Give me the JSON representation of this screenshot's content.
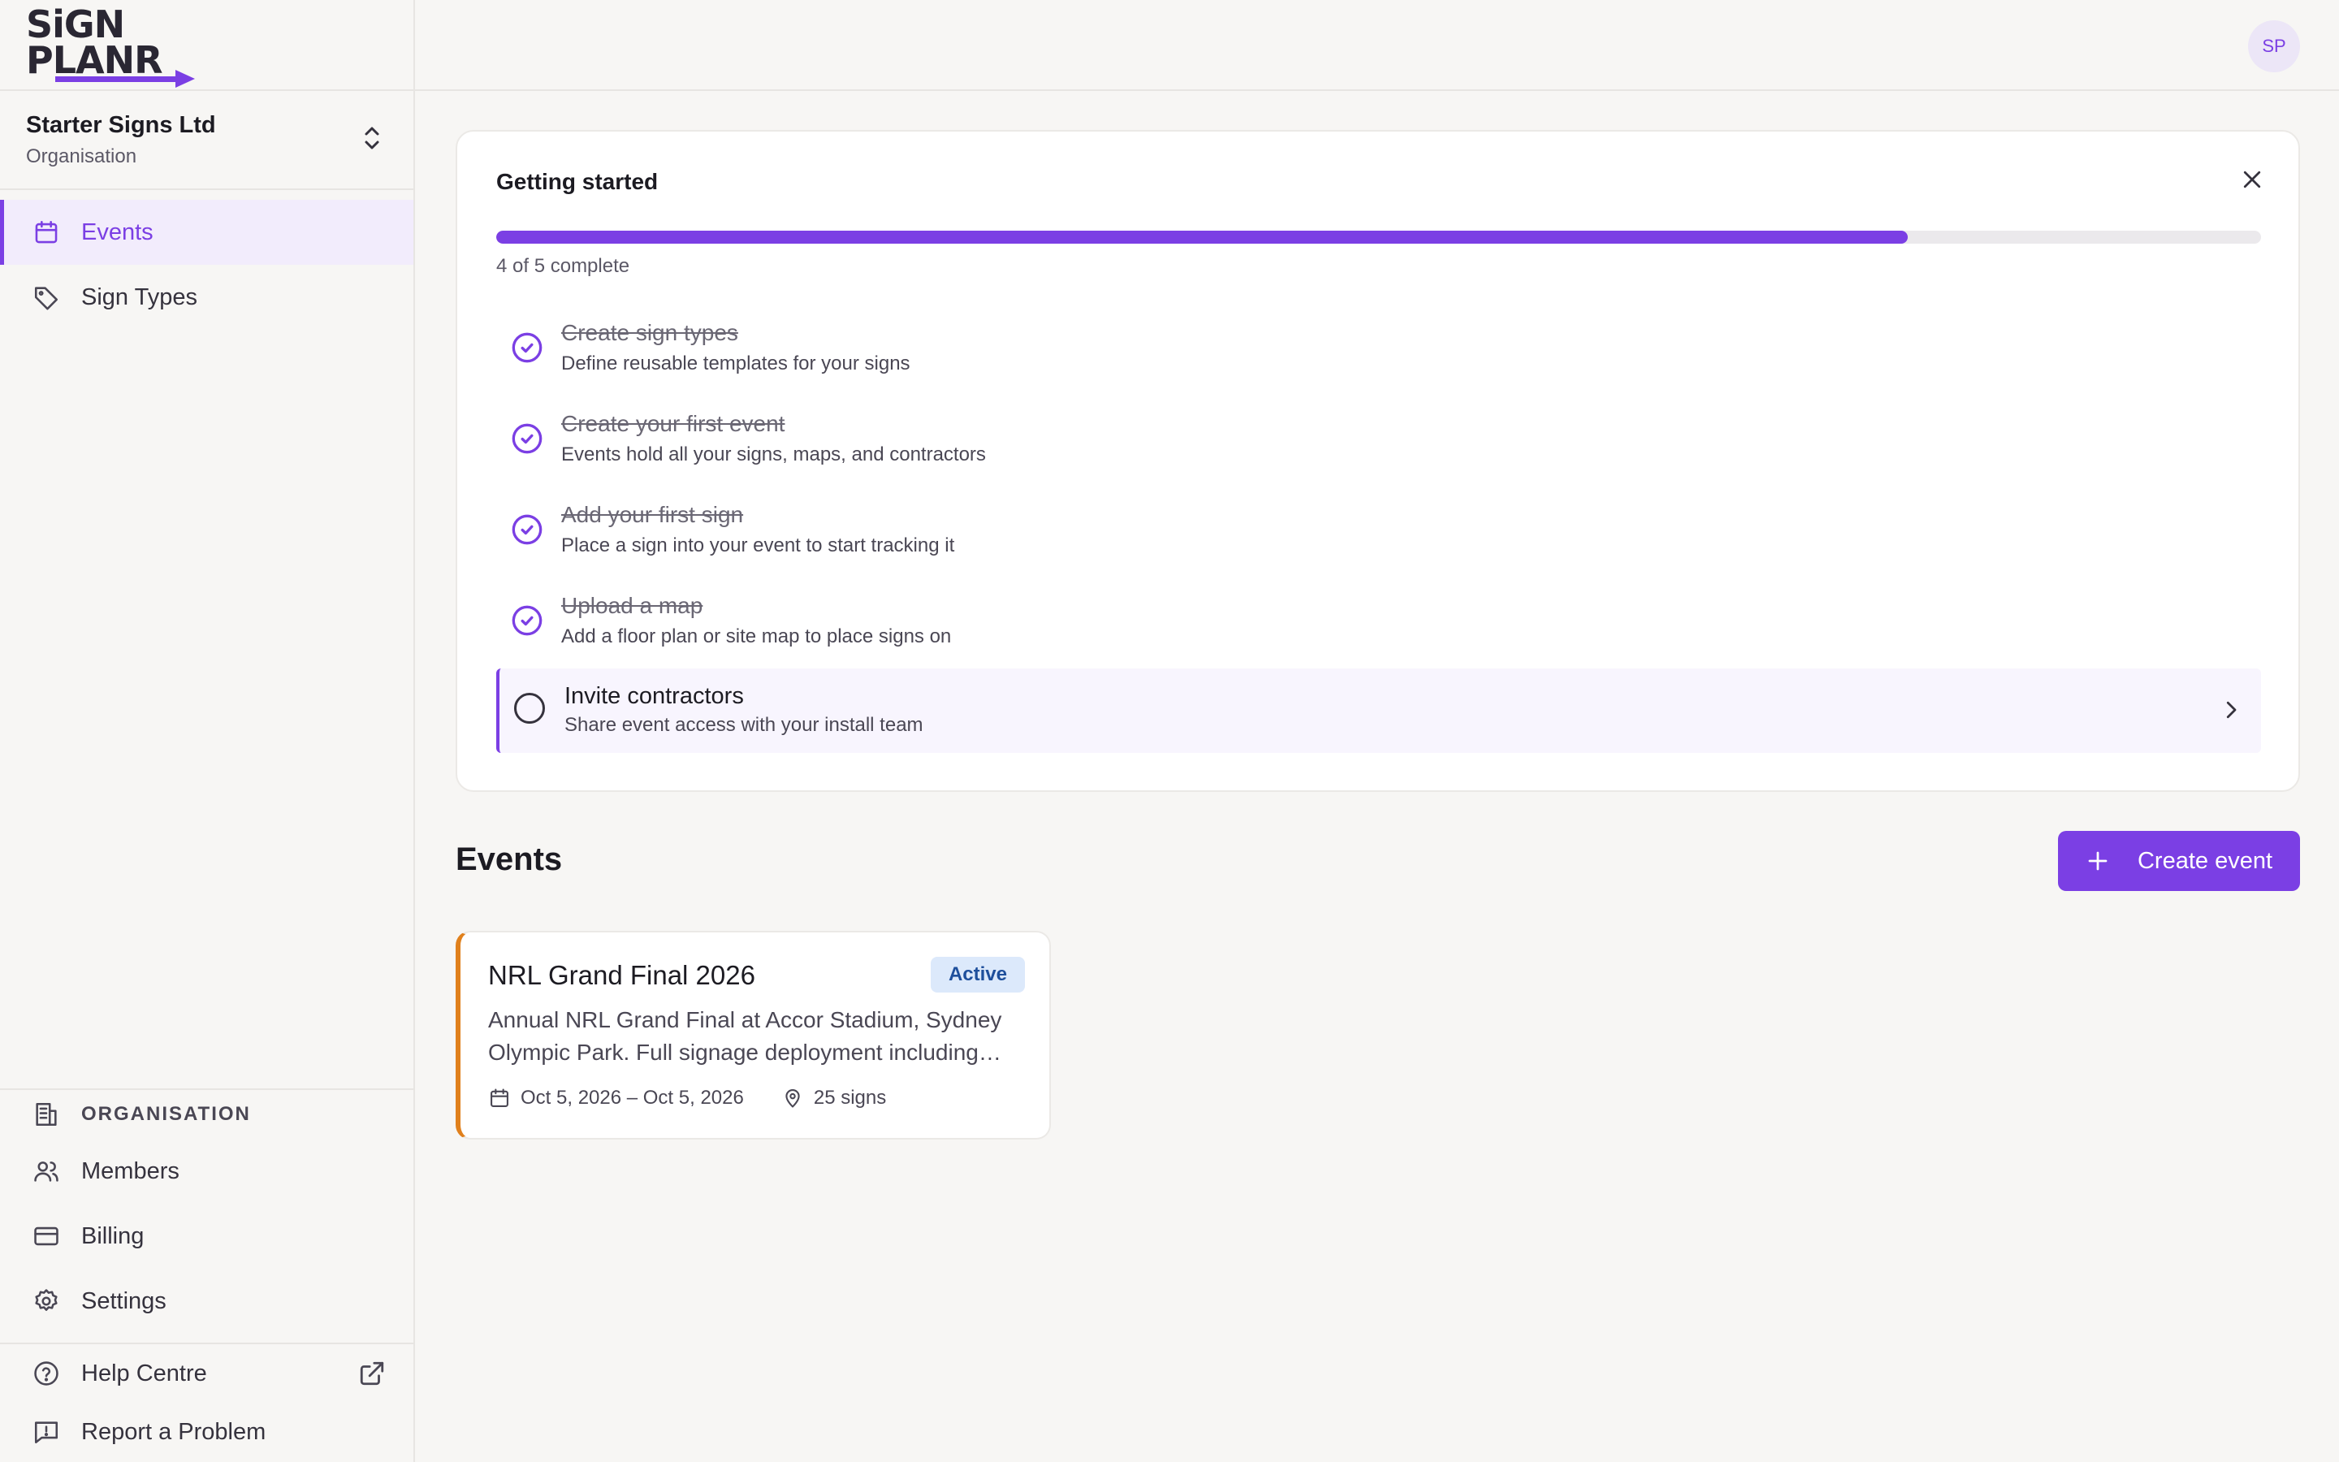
{
  "app": {
    "logo_line1": "SiGN",
    "logo_line2": "PLANR",
    "brand_color": "#7b3fe4"
  },
  "org": {
    "name": "Starter Signs Ltd",
    "subtitle": "Organisation"
  },
  "sidebar": {
    "nav": [
      {
        "label": "Events",
        "icon": "calendar-icon",
        "active": true
      },
      {
        "label": "Sign Types",
        "icon": "tag-icon",
        "active": false
      }
    ],
    "section_label": "ORGANISATION",
    "org_items": [
      {
        "label": "Members",
        "icon": "users-icon"
      },
      {
        "label": "Billing",
        "icon": "credit-card-icon"
      },
      {
        "label": "Settings",
        "icon": "gear-icon"
      }
    ],
    "footer_items": [
      {
        "label": "Help Centre",
        "icon": "help-circle-icon"
      },
      {
        "label": "Report a Problem",
        "icon": "report-icon"
      }
    ]
  },
  "user": {
    "initials": "SP"
  },
  "getting_started": {
    "title": "Getting started",
    "progress": 0.8,
    "count_text": "4 of 5 complete",
    "tasks": [
      {
        "title": "Create sign types",
        "desc": "Define reusable templates for your signs",
        "done": true
      },
      {
        "title": "Create your first event",
        "desc": "Events hold all your signs, maps, and contractors",
        "done": true
      },
      {
        "title": "Add your first sign",
        "desc": "Place a sign into your event to start tracking it",
        "done": true
      },
      {
        "title": "Upload a map",
        "desc": "Add a floor plan or site map to place signs on",
        "done": true
      },
      {
        "title": "Invite contractors",
        "desc": "Share event access with your install team",
        "done": false
      }
    ]
  },
  "events": {
    "heading": "Events",
    "create_label": "Create event",
    "items": [
      {
        "title": "NRL Grand Final 2026",
        "status": "Active",
        "description": "Annual NRL Grand Final at Accor Stadium, Sydney Olympic Park. Full signage deployment including…",
        "dates": "Oct 5, 2026 – Oct 5, 2026",
        "signs": "25 signs",
        "accent": "#e0801c"
      }
    ]
  }
}
